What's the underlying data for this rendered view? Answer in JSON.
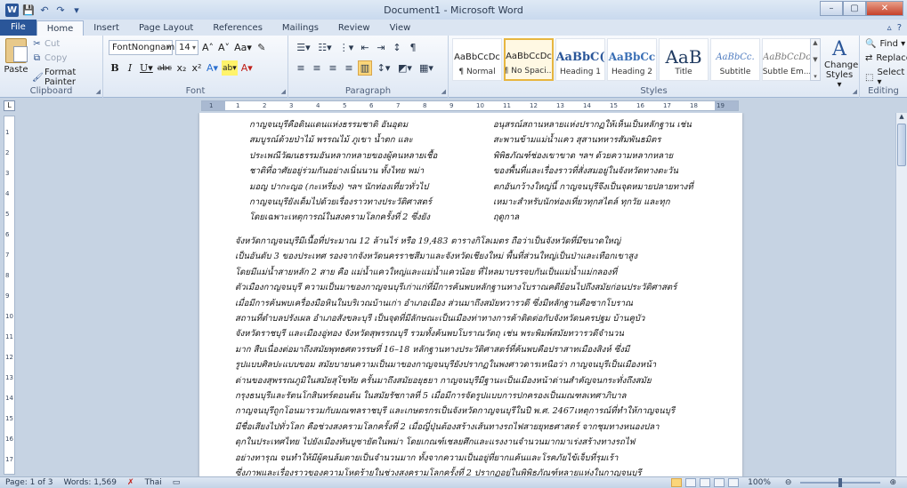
{
  "window": {
    "title": "Document1 - Microsoft Word",
    "controls": {
      "minimize": "–",
      "maximize": "▢",
      "close": "✕"
    }
  },
  "quick_access": {
    "logo": "W",
    "icons": [
      "save-icon",
      "undo-icon",
      "redo-icon",
      "customize-icon"
    ],
    "glyphs": [
      "💾",
      "↶",
      "↷",
      "▾"
    ]
  },
  "tabs": [
    {
      "label": "File"
    },
    {
      "label": "Home"
    },
    {
      "label": "Insert"
    },
    {
      "label": "Page Layout"
    },
    {
      "label": "References"
    },
    {
      "label": "Mailings"
    },
    {
      "label": "Review"
    },
    {
      "label": "View"
    }
  ],
  "tabs_right_glyphs": [
    "▵",
    "?"
  ],
  "clipboard": {
    "paste": "Paste",
    "cut": "Cut",
    "copy": "Copy",
    "format_painter": "Format Painter",
    "label": "Clipboard",
    "glyphs": {
      "cut": "✂",
      "copy": "⧉",
      "painter": "🖌"
    }
  },
  "font": {
    "name": "FontNongnam",
    "size": "14",
    "label": "Font",
    "row1_glyphs": [
      "A˄",
      "A˅",
      "Aa▾",
      "✎"
    ],
    "row2_glyphs": [
      "B",
      "I",
      "U▾",
      "abc",
      "x₂",
      "x²",
      "A▾",
      "ab▾",
      "A▾"
    ]
  },
  "paragraph": {
    "label": "Paragraph",
    "row1_glyphs": [
      "☰▾",
      "☷▾",
      "⋮▾",
      "⇤",
      "⇥",
      "↕",
      "¶"
    ],
    "row2_glyphs": [
      "≡",
      "≡",
      "≡",
      "≡",
      "▥",
      "↕▾",
      "◩▾",
      "▦▾"
    ]
  },
  "styles": {
    "label": "Styles",
    "items": [
      {
        "sample": "AaBbCcDc",
        "name": "¶ Normal",
        "selected": false
      },
      {
        "sample": "AaBbCcDc",
        "name": "¶ No Spaci...",
        "selected": true
      },
      {
        "sample": "AaBbC(",
        "name": "Heading 1",
        "selected": false
      },
      {
        "sample": "AaBbCc",
        "name": "Heading 2",
        "selected": false
      },
      {
        "sample": "AaB",
        "name": "Title",
        "selected": false
      },
      {
        "sample": "AaBbCc.",
        "name": "Subtitle",
        "selected": false
      },
      {
        "sample": "AaBbCcDc",
        "name": "Subtle Em...",
        "selected": false
      }
    ],
    "change_styles": "Change Styles ▾",
    "change_styles_glyph": "A"
  },
  "editing": {
    "label": "Editing",
    "find": "Find ▾",
    "replace": "Replace",
    "select": "Select ▾",
    "glyphs": {
      "find": "🔍",
      "replace": "⇄",
      "select": "⬚"
    }
  },
  "ruler": {
    "corner": "L",
    "numbers": [
      "1",
      "1",
      "2",
      "3",
      "4",
      "5",
      "6",
      "7",
      "8",
      "9",
      "10",
      "11",
      "12",
      "13",
      "14",
      "15",
      "16",
      "17",
      "18",
      "19"
    ],
    "vnumbers": [
      "1",
      "2",
      "3",
      "4",
      "5",
      "6",
      "7",
      "8",
      "9",
      "10",
      "11",
      "12",
      "13",
      "14",
      "15",
      "16",
      "17"
    ]
  },
  "document": {
    "col_left": "กาญจนบุรีคือดินแดนแห่งธรรมชาติ อันอุดม\nสมบูรณ์ด้วยป่าไม้ พรรณไม้ ภูเขา น้ำตก และ\nประเพณีวัฒนธรรมอันหลากหลายของผู้คนหลายเชื้อ\nชาติที่อาศัยอยู่ร่วมกันอย่างเนิ่นนาน ทั้งไทย พม่า\nมอญ ปากะญอ (กะเหรี่ยง) ฯลฯ นักท่องเที่ยวทั่วไป\nกาญจนบุรียังเต็มไปด้วยเรื่องราวทางประวัติศาสตร์\nโดยเฉพาะเหตุการณ์ในสงครามโลกครั้งที่ 2 ซึ่งยัง",
    "col_right": "อนุสรณ์สถานหลายแห่งปรากฏให้เห็นเป็นหลักฐาน เช่น\nสะพานข้ามแม่น้ำแคว สุสานทหารสัมพันธมิตร\nพิพิธภัณฑ์ช่องเขาขาด ฯลฯ ด้วยความหลากหลาย\nของพื้นที่และเรื่องราวที่สั่งสมอยู่ในจังหวัดทางตะวัน\nตกอันกว้างใหญ่นี้ กาญจนบุรีจึงเป็นจุดหมายปลายทางที่\nเหมาะสำหรับนักท่องเที่ยวทุกสไตล์ ทุกวัย และทุก\nฤดูกาล",
    "body": "จังหวัดกาญจนบุรีมีเนื้อที่ประมาณ 12 ล้านไร่ หรือ 19,483 ตารางกิโลเมตร ถือว่าเป็นจังหวัดที่มีขนาดใหญ่\nเป็นอันดับ 3 ของประเทศ รองจากจังหวัดนครราชสีมาและจังหวัดเชียงใหม่ พื้นที่ส่วนใหญ่เป็นป่าและเทือกเขาสูง\nโดยมีแม่น้ำสายหลัก 2 สาย คือ แม่น้ำแควใหญ่และแม่น้ำแควน้อย ที่ไหลมาบรรจบกันเป็นแม่น้ำแม่กลองที่\nตัวเมืองกาญจนบุรี ความเป็นมาของกาญจนบุรีเก่าแก่ที่มีการค้นพบหลักฐานทางโบราณคดีย้อนไปถึงสมัยก่อนประวัติศาสตร์\nเมื่อมีการค้นพบเครื่องมือหินในบริเวณบ้านเก่า อำเภอเมือง ส่วนมาถึงสมัยทวารวดี ซึ่งมีหลักฐานคือซากโบราณ\nสถานที่ตำบลปรังเผล อำเภอสังขละบุรี เป็นจุดที่มีลักษณะเป็นเมืองท่าทางการค้าติดต่อกับจังหวัดนครปฐม บ้านคูบัว\nจังหวัดราชบุรี และเมืองอู่ทอง จังหวัดสุพรรณบุรี รวมทั้งค้นพบโบราณวัตถุ เช่น พระพิมพ์สมัยทวารวดีจำนวน\nมาก สืบเนื่องต่อมาถึงสมัยพุทธศตวรรษที่ 16–18 หลักฐานทางประวัติศาสตร์ที่ค้นพบคือปราสาทเมืองสิงห์ ซึ่งมี\nรูปแบบศิลปะแบบขอม สมัยบายนความเป็นมาของกาญจนบุรียังปรากฏในพงศาวดารเหนือว่า กาญจนบุรีเป็นเมืองหน้า\nด่านของสุพรรณภูมิในสมัยสุโขทัย ครั้นมาถึงสมัยอยุธยา กาญจนบุรีมีฐานะเป็นเมืองหน้าด่านสำคัญจนกระทั่งถึงสมัย\nกรุงธนบุรีและรัตนโกสินทร์ตอนต้น ในสมัยรัชกาลที่ 5 เมื่อมีการจัดรูปแบบการปกครองเป็นมณฑลเทศาภิบาล\nกาญจนบุรีถูกโอนมารวมกับมณฑลราชบุรี และเกษตรกรเป็นจังหวัดกาญจนบุรีในปี พ.ศ. 2467เหตุการณ์ที่ทำให้กาญจนบุรี\nมีชื่อเสียงไปทั่วโลก คือช่วงสงครามโลกครั้งที่ 2 เมื่อญี่ปุ่นต้องสร้างเส้นทางรถไฟสายยุทธศาสตร์ จากชุมทางหนองปลา\nดุกในประเทศไทย ไปยังเมืองทันบูซายัตในพม่า โดยเกณฑ์เชลยศึกและแรงงานจำนวนมากมาเร่งสร้างทางรถไฟ\nอย่างทารุณ จนทำให้มีผู้คนล้มตายเป็นจำนวนมาก ทั้งจากความเป็นอยู่ที่ยากแค้นและโรคภัยไข้เจ็บที่รุมเร้า\nซึ่งภาพและเรื่องราวของความโหดร้ายในช่วงสงครามโลกครั้งที่ 2 ปรากฏอยู่ในพิพิธภัณฑ์หลายแห่งในกาญจนบุรี"
  },
  "status": {
    "page": "Page: 1 of 3",
    "words": "Words: 1,569",
    "lang": "Thai",
    "zoom": "100%",
    "zoom_value": 100
  }
}
